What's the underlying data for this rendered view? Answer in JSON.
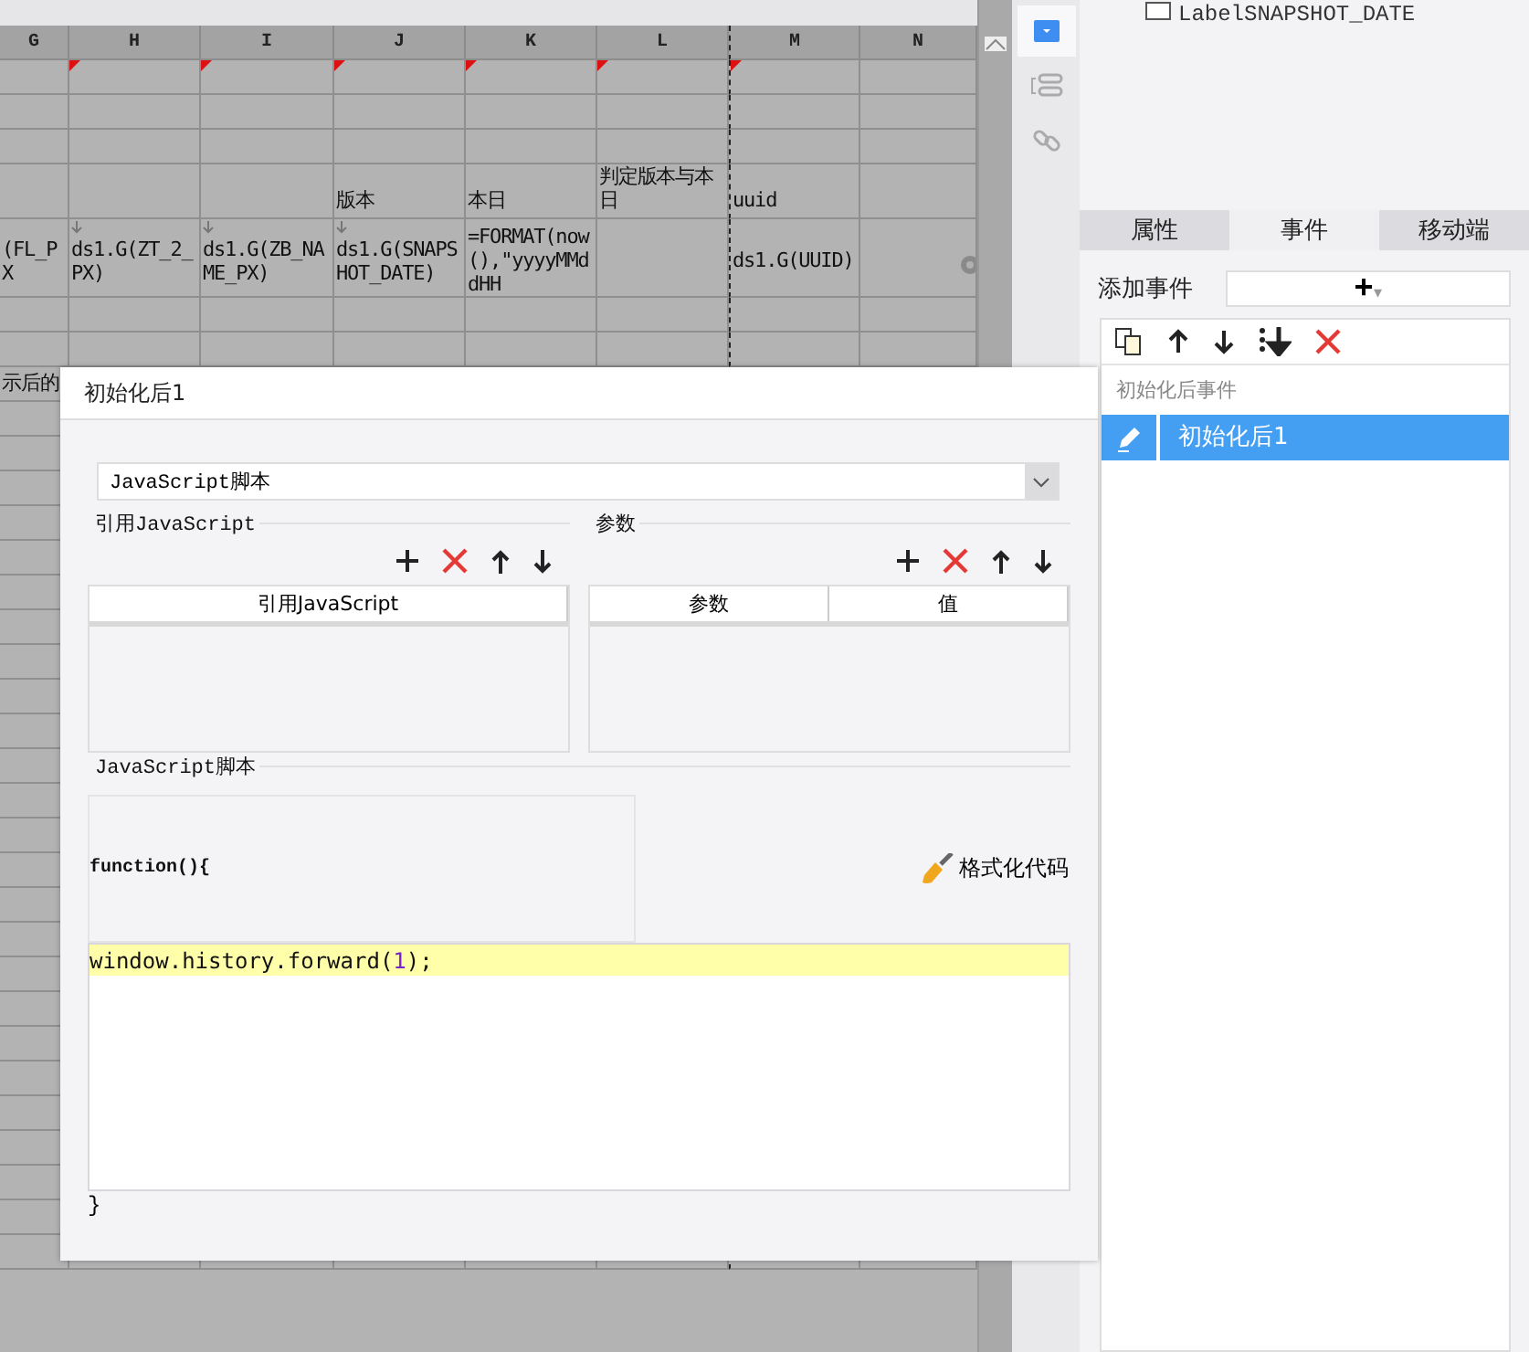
{
  "sheet": {
    "columns": [
      "G",
      "H",
      "I",
      "J",
      "K",
      "L",
      "M",
      "N"
    ],
    "rows": [
      {
        "cells": [
          {
            "corner_mark": false
          },
          {
            "corner_mark": true
          },
          {
            "corner_mark": true
          },
          {
            "corner_mark": true
          },
          {
            "corner_mark": true
          },
          {
            "corner_mark": true
          },
          {
            "corner_mark": true
          },
          {
            "corner_mark": false
          }
        ]
      },
      {
        "cells": []
      },
      {
        "cells": []
      },
      {
        "cells": [
          {
            "text": ""
          },
          {
            "text": ""
          },
          {
            "text": ""
          },
          {
            "text": "版本"
          },
          {
            "text": "本日"
          },
          {
            "text": "判定版本与本日"
          },
          {
            "text": "uuid"
          }
        ]
      },
      {
        "cells": [
          {
            "text": "(FL_PX",
            "expand_arrow": false
          },
          {
            "text": "ds1.G(ZT_2_PX)",
            "expand_arrow": true
          },
          {
            "text": "ds1.G(ZB_NAME_PX)",
            "expand_arrow": true
          },
          {
            "text": "ds1.G(SNAPSHOT_DATE)",
            "expand_arrow": true
          },
          {
            "text": "=FORMAT(now(),\"yyyyMMddHH",
            "expand_arrow": false
          },
          {
            "text": ""
          },
          {
            "text": "ds1.G(UUID)",
            "expand_arrow": false
          }
        ]
      },
      {
        "cells": []
      },
      {
        "cells": []
      },
      {
        "cells": [
          {
            "text": "示后的"
          }
        ]
      }
    ]
  },
  "tree_item": {
    "label": "LabelSNAPSHOT_DATE"
  },
  "side_tools": [
    {
      "selected": true
    },
    {
      "selected": false
    },
    {
      "selected": false
    }
  ],
  "panel_tabs": [
    {
      "label": "属性",
      "selected": false
    },
    {
      "label": "事件",
      "selected": true
    },
    {
      "label": "移动端",
      "selected": false
    }
  ],
  "add_event": {
    "label": "添加事件",
    "button": "+",
    "caret": "▾"
  },
  "events": {
    "group": "初始化后事件",
    "items": [
      {
        "label": "初始化后1",
        "selected": true
      }
    ]
  },
  "dialog": {
    "title": "初始化后1",
    "type_select": "JavaScript脚本",
    "refs": {
      "title": "引用JavaScript",
      "columns": [
        "引用JavaScript"
      ]
    },
    "params": {
      "title": "参数",
      "columns": [
        "参数",
        "值"
      ]
    },
    "script": {
      "title": "JavaScript脚本",
      "head": "function(){",
      "format_button": "格式化代码",
      "lines": [
        {
          "text": "window.history.forward(**1**);",
          "highlighted": true
        }
      ],
      "tail": "}"
    }
  }
}
